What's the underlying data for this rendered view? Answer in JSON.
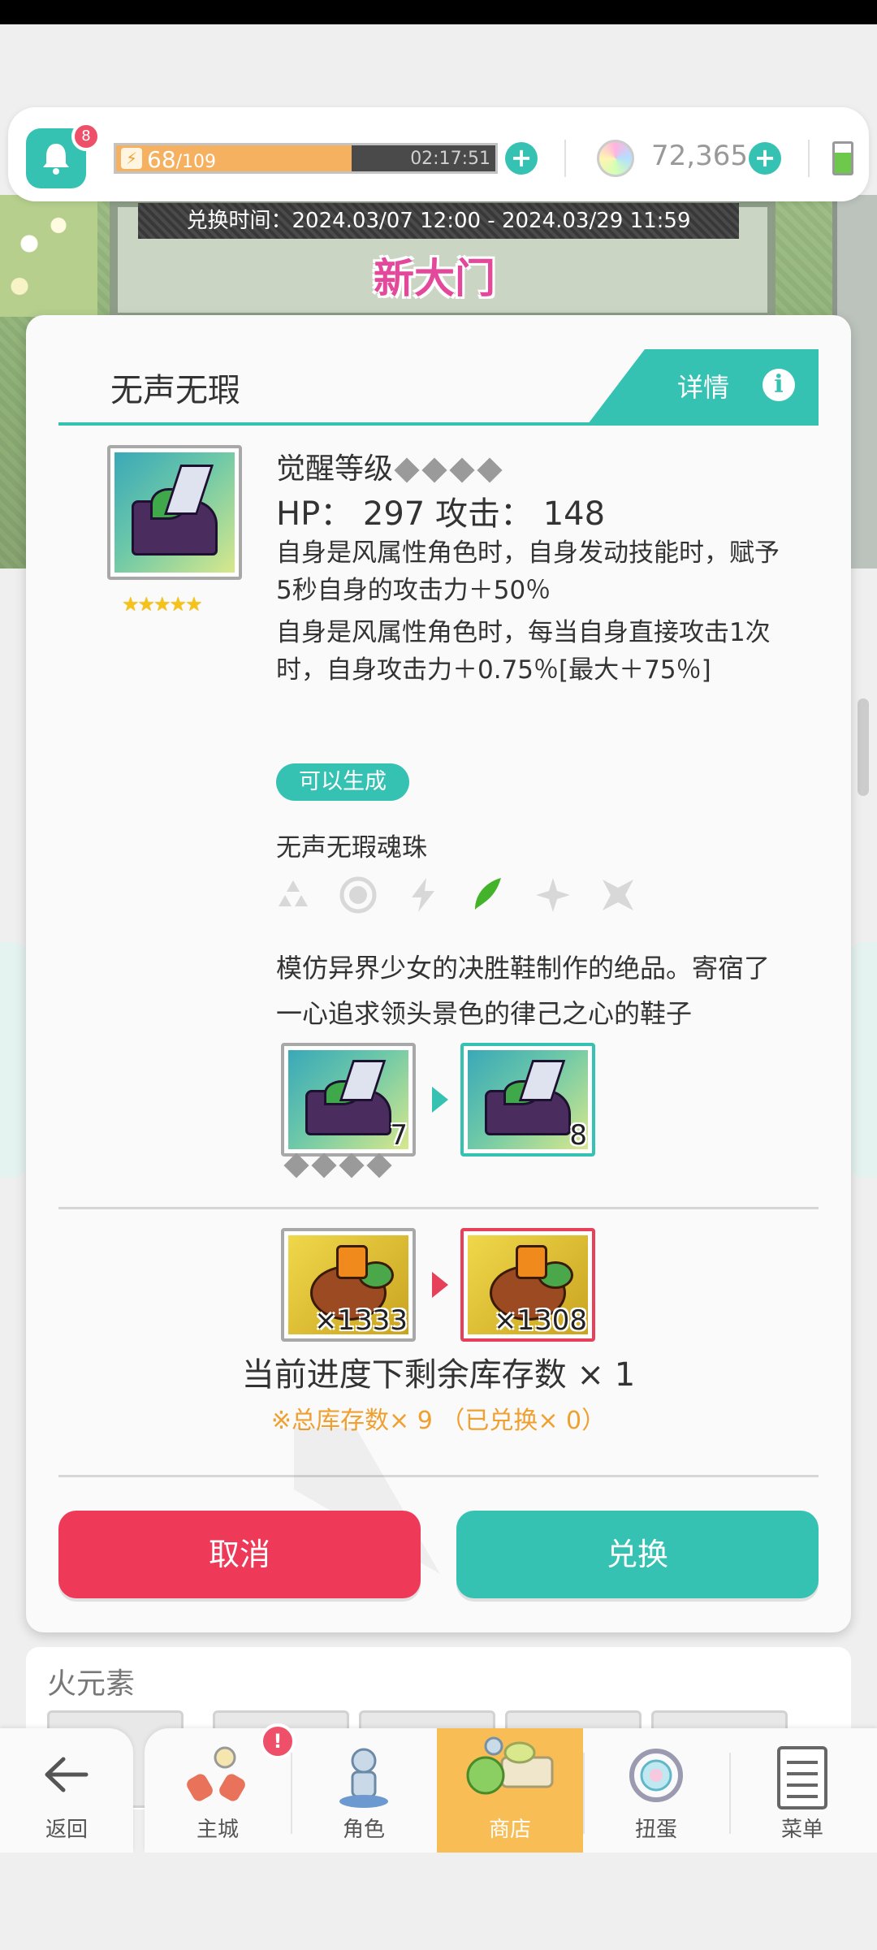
{
  "header": {
    "notifications_badge": "8",
    "stamina_current": "68",
    "stamina_max": "/109",
    "stamina_fraction": 0.62,
    "stamina_timer": "02:17:51",
    "gems": "72,365"
  },
  "event": {
    "exchange_time": "兑换时间：2024.03/07 12:00 - 2024.03/29 11:59",
    "logo": "新大门"
  },
  "dialog": {
    "title": "无声无瑕",
    "detail_label": "详情",
    "awaken_label": "觉醒等级",
    "stats": "HP： 297   攻击： 148",
    "desc1": "自身是风属性角色时，自身发动技能时，赋予5秒自身的攻击力＋50％",
    "desc2": "自身是风属性角色时，每当自身直接攻击1次时，自身攻击力＋0.75％[最大＋75％]",
    "craft_badge": "可以生成",
    "orb_name": "无声无瑕魂珠",
    "flavor": "模仿异界少女的决胜鞋制作的绝品。寄宿了一心追求领头景色的律己之心的鞋子",
    "upgrade_from": "7",
    "upgrade_to": "8",
    "material_from": "×1333",
    "material_to": "×1308",
    "stock_label": "当前进度下剩余库存数 × 1",
    "stock_note": "※总库存数× 9 （已兑换× 0）",
    "cancel_label": "取消",
    "exchange_label": "兑换"
  },
  "elements": [
    "earth",
    "water",
    "thunder",
    "wind",
    "light",
    "dark"
  ],
  "fire_panel": {
    "title": "火元素"
  },
  "nav": {
    "back": "返回",
    "tabs": [
      {
        "label": "主城"
      },
      {
        "label": "角色"
      },
      {
        "label": "商店"
      },
      {
        "label": "扭蛋"
      },
      {
        "label": "菜单"
      }
    ],
    "badge": "!"
  },
  "colors": {
    "accent": "#35c2b3",
    "danger": "#ee3a58",
    "warning": "#f0a030",
    "active_tab": "#f9bd56"
  }
}
